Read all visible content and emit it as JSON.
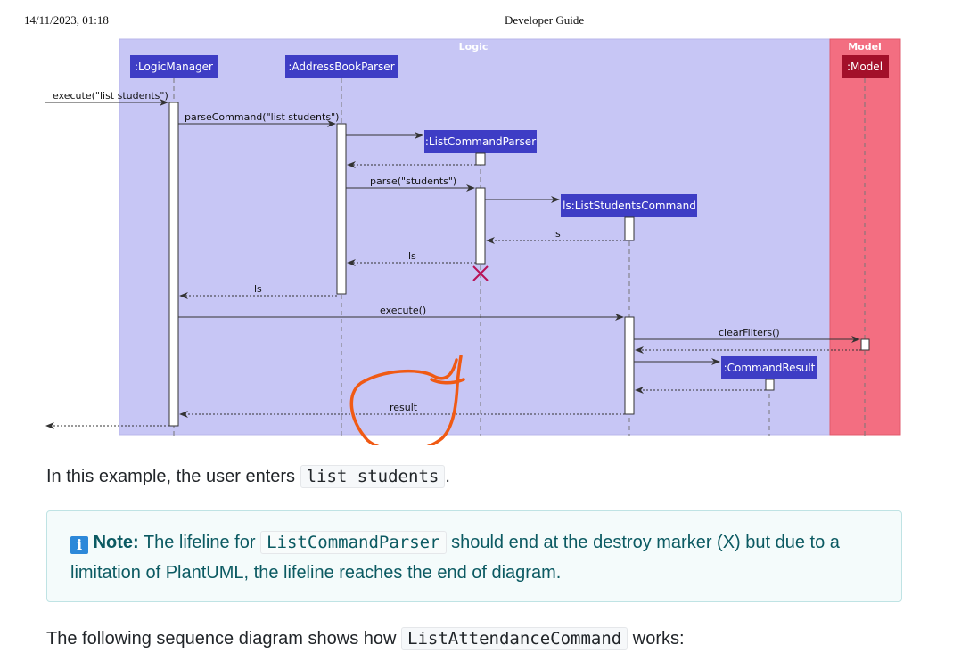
{
  "header": {
    "timestamp": "14/11/2023, 01:18",
    "title": "Developer Guide"
  },
  "diagram": {
    "box_logic": "Logic",
    "box_model": "Model",
    "participants": {
      "logic_manager": ":LogicManager",
      "parser": ":AddressBookParser",
      "list_cmd_parser": ":ListCommandParser",
      "list_students_cmd": "ls:ListStudentsCommand",
      "command_result": ":CommandResult",
      "model": ":Model"
    },
    "messages": {
      "execute_in": "execute(\"list students\")",
      "parse_command": "parseCommand(\"list students\")",
      "parse": "parse(\"students\")",
      "ret_ls_1": "ls",
      "ret_ls_2": "ls",
      "ret_ls_3": "ls",
      "execute": "execute()",
      "clear_filters": "clearFilters()",
      "result": "result"
    },
    "colors": {
      "logic_bg": "#c7c6f5",
      "model_bg": "#f36e81",
      "participant": "#3e3dc5",
      "model_participant": "#a3102a",
      "destroy": "#b81257",
      "annotation": "#f05a14"
    }
  },
  "para1": {
    "before": "In this example, the user enters",
    "code": "list students",
    "after": "."
  },
  "note": {
    "icon": "info-icon",
    "label": "Note:",
    "text1": "The lifeline for",
    "code": "ListCommandParser",
    "text2": "should end at the destroy marker (X) but due to a limitation of PlantUML, the lifeline reaches the end of diagram."
  },
  "para2": {
    "before": "The following sequence diagram shows how",
    "code": "ListAttendanceCommand",
    "after": "works:"
  }
}
